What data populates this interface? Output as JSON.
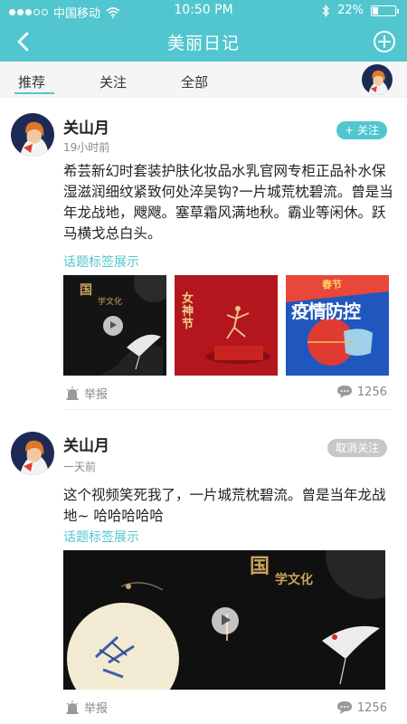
{
  "status_bar": {
    "carrier": "中国移动",
    "time": "10:50 PM",
    "battery": "22%",
    "battery_level": 0.22,
    "signal_icon": "signal-dots-icon",
    "wifi_icon": "wifi-icon",
    "bluetooth_icon": "bluetooth-icon"
  },
  "nav": {
    "title": "美丽日记",
    "back_icon": "back-arrow-icon",
    "add_icon": "plus-circle-icon"
  },
  "tabs": [
    {
      "label": "推荐",
      "active": true
    },
    {
      "label": "关注",
      "active": false
    },
    {
      "label": "全部",
      "active": false
    }
  ],
  "colors": {
    "accent": "#52c6cf",
    "follow_teal": "#52c6cf",
    "unfollow_gray": "#c7c7c7"
  },
  "posts": [
    {
      "username": "关山月",
      "time": "19小时前",
      "follow_label": "+ 关注",
      "text": "希芸新幻时套装护肤化妆品水乳官网专柜正品补水保湿滋润细纹紧致何处淬吴钩?一片城荒枕碧流。曾是当年龙战地，飕飕。塞草霜风满地秋。霸业等闲休。跃马横戈总白头。",
      "tag": "话题标签展示",
      "images": [
        {
          "text_a": "国",
          "text_b": "学文化",
          "has_play": true
        },
        {
          "text_a": "女神节",
          "has_play": false
        },
        {
          "text_a": "春节",
          "text_b": "疫情防控",
          "has_play": false
        }
      ],
      "report_label": "举报",
      "comment_count": "1256"
    },
    {
      "username": "关山月",
      "time": "一天前",
      "follow_label": "取消关注",
      "text": "这个视频笑死我了，一片城荒枕碧流。曾是当年龙战地~ 哈哈哈哈哈",
      "tag": "话题标签展示",
      "video": {
        "text_a": "国",
        "text_b": "学文化",
        "has_play": true
      },
      "report_label": "举报",
      "comment_count": "1256"
    }
  ]
}
